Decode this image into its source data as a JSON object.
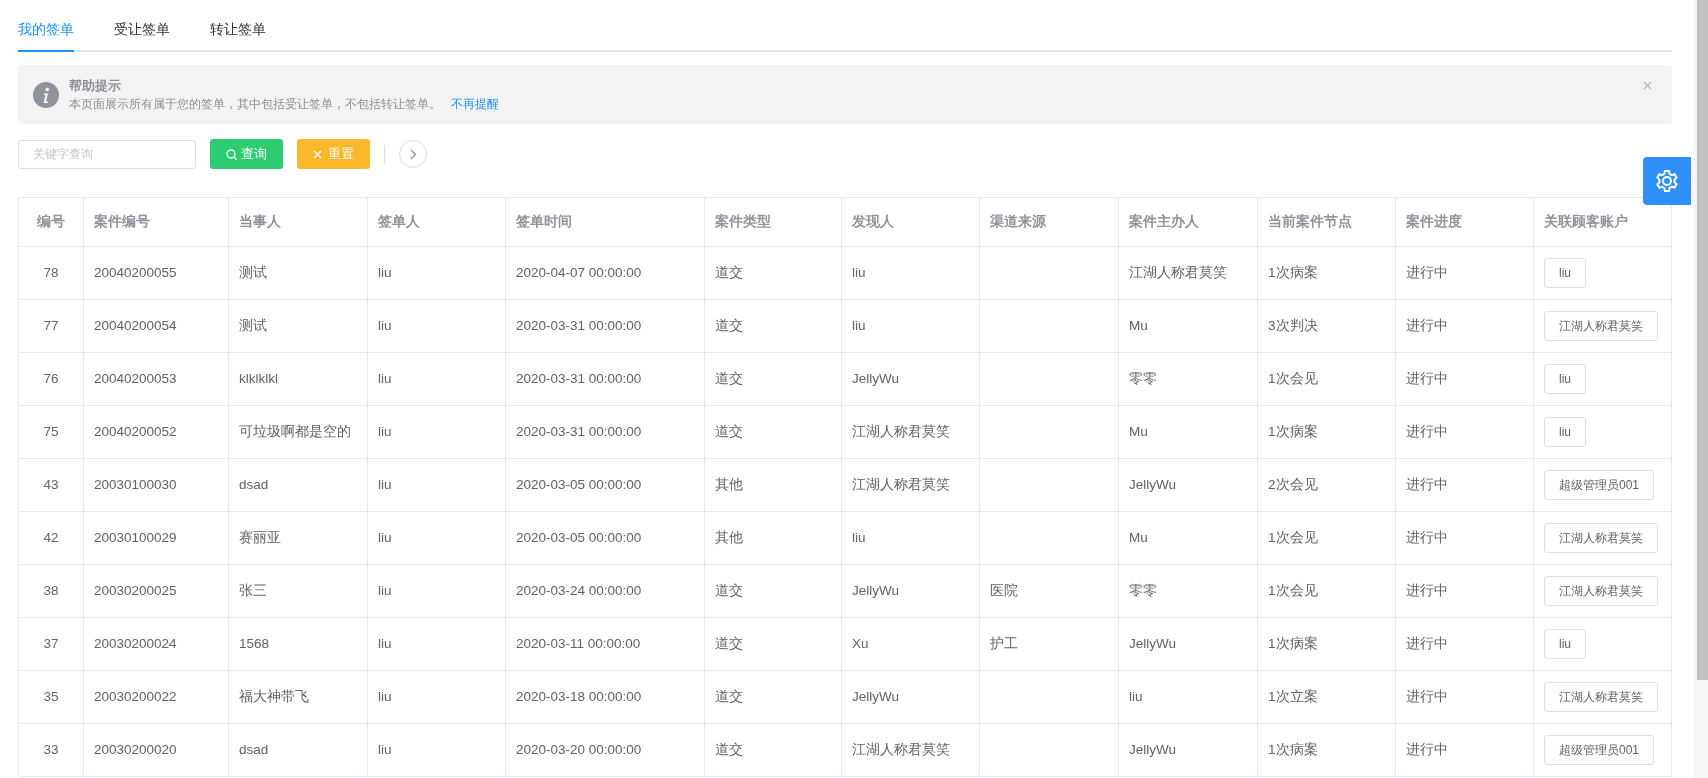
{
  "tabs": [
    {
      "label": "我的签单",
      "selected": true
    },
    {
      "label": "受让签单",
      "selected": false
    },
    {
      "label": "转让签单",
      "selected": false
    }
  ],
  "alert": {
    "title": "帮助提示",
    "text": "本页面展示所有属于您的签单，其中包括受让签单，不包括转让签单。",
    "link": "不再提醒"
  },
  "search": {
    "placeholder": "关键字查询"
  },
  "buttons": [
    {
      "kind": "search",
      "label": "查询"
    },
    {
      "kind": "reset",
      "label": "重置"
    }
  ],
  "table": {
    "columns": [
      "编号",
      "案件编号",
      "当事人",
      "签单人",
      "签单时间",
      "案件类型",
      "发现人",
      "渠道来源",
      "案件主办人",
      "当前案件节点",
      "案件进度",
      "关联顾客账户"
    ],
    "rows": [
      {
        "cells": [
          "78",
          "20040200055",
          "测试",
          "liu",
          "2020-04-07 00:00:00",
          "道交",
          "liu",
          "",
          "江湖人称君莫笑",
          "1次病案",
          "进行中"
        ],
        "account": "liu"
      },
      {
        "cells": [
          "77",
          "20040200054",
          "测试",
          "liu",
          "2020-03-31 00:00:00",
          "道交",
          "liu",
          "",
          "Mu",
          "3次判决",
          "进行中"
        ],
        "account": "江湖人称君莫笑"
      },
      {
        "cells": [
          "76",
          "20040200053",
          "klklklkl",
          "liu",
          "2020-03-31 00:00:00",
          "道交",
          "JellyWu",
          "",
          "零零",
          "1次会见",
          "进行中"
        ],
        "account": "liu"
      },
      {
        "cells": [
          "75",
          "20040200052",
          "可垃圾啊都是空的",
          "liu",
          "2020-03-31 00:00:00",
          "道交",
          "江湖人称君莫笑",
          "",
          "Mu",
          "1次病案",
          "进行中"
        ],
        "account": "liu"
      },
      {
        "cells": [
          "43",
          "20030100030",
          "dsad",
          "liu",
          "2020-03-05 00:00:00",
          "其他",
          "江湖人称君莫笑",
          "",
          "JellyWu",
          "2次会见",
          "进行中"
        ],
        "account": "超级管理员001"
      },
      {
        "cells": [
          "42",
          "20030100029",
          "赛丽亚",
          "liu",
          "2020-03-05 00:00:00",
          "其他",
          "liu",
          "",
          "Mu",
          "1次会见",
          "进行中"
        ],
        "account": "江湖人称君莫笑"
      },
      {
        "cells": [
          "38",
          "20030200025",
          "张三",
          "liu",
          "2020-03-24 00:00:00",
          "道交",
          "JellyWu",
          "医院",
          "零零",
          "1次会见",
          "进行中"
        ],
        "account": "江湖人称君莫笑"
      },
      {
        "cells": [
          "37",
          "20030200024",
          "1568",
          "liu",
          "2020-03-11 00:00:00",
          "道交",
          "Xu",
          "护工",
          "JellyWu",
          "1次病案",
          "进行中"
        ],
        "account": "liu"
      },
      {
        "cells": [
          "35",
          "20030200022",
          "福大神带飞",
          "liu",
          "2020-03-18 00:00:00",
          "道交",
          "JellyWu",
          "",
          "liu",
          "1次立案",
          "进行中"
        ],
        "account": "江湖人称君莫笑"
      },
      {
        "cells": [
          "33",
          "20030200020",
          "dsad",
          "liu",
          "2020-03-20 00:00:00",
          "道交",
          "江湖人称君莫笑",
          "",
          "JellyWu",
          "1次病案",
          "进行中"
        ],
        "account": "超级管理员001"
      }
    ]
  }
}
